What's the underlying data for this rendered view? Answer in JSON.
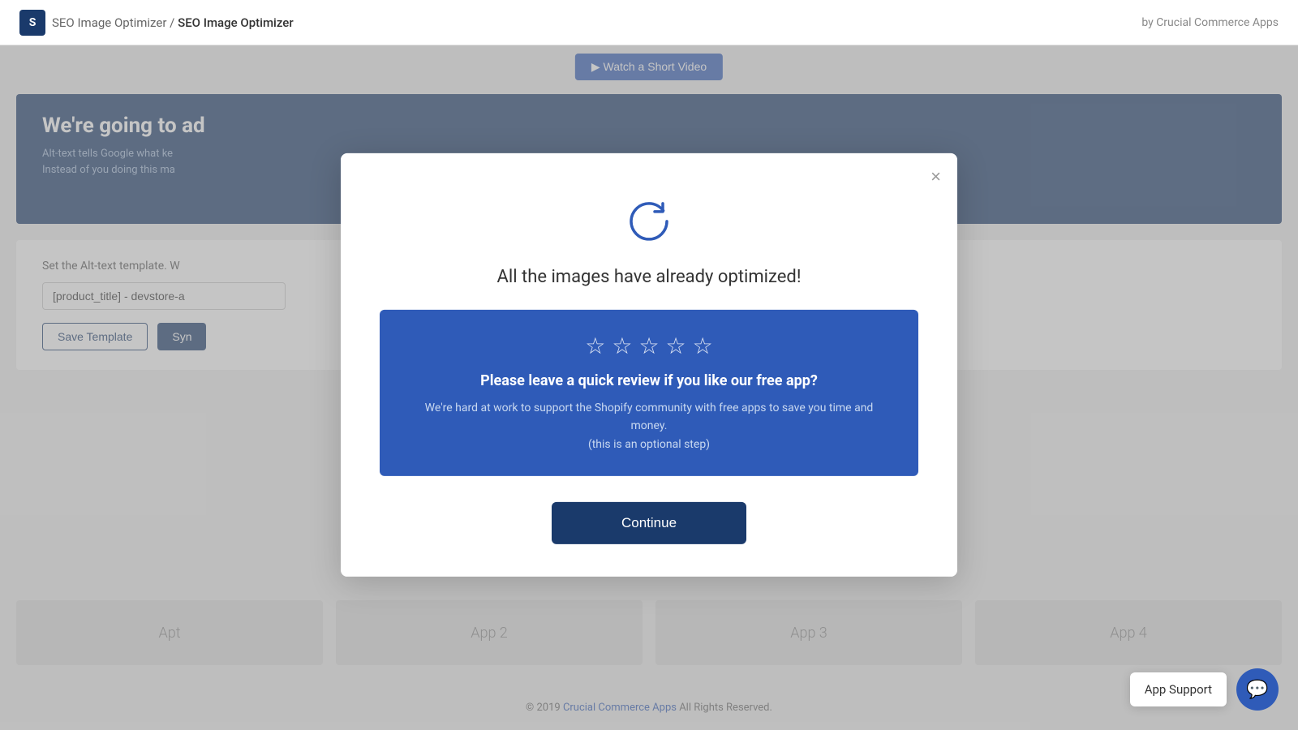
{
  "header": {
    "logo_text": "S",
    "breadcrumb_parent": "SEO Image Optimizer",
    "separator": "/",
    "breadcrumb_current": "SEO Image Optimizer",
    "by_text": "by Crucial Commerce Apps"
  },
  "background": {
    "watch_video_btn": "▶ Watch a Short Video",
    "banner_heading": "We're going to ad",
    "banner_line1": "Alt-text tells Google what ke",
    "banner_line2": "Instead of you doing this ma",
    "template_label": "Set the Alt-text template. W",
    "template_input_value": "[product_title] - devstore-a",
    "save_template_btn": "Save Template",
    "sync_btn": "Syn",
    "app_card_1": "Apt",
    "app_card_2": "App 2",
    "app_card_3": "App 3",
    "app_card_4": "App 4",
    "footer_copy": "© 2019",
    "footer_link": "Crucial Commerce Apps",
    "footer_rights": "All Rights Reserved."
  },
  "modal": {
    "close_label": "×",
    "title": "All the images have already optimized!",
    "review_box": {
      "stars": [
        "☆",
        "☆",
        "☆",
        "☆",
        "☆"
      ],
      "heading": "Please leave a quick review if you like our free app?",
      "desc_line1": "We're hard at work to support the Shopify community with free apps to save you time and money.",
      "desc_line2": "(this is an optional step)"
    },
    "continue_btn": "Continue"
  },
  "app_support": {
    "label": "App Support",
    "chat_icon": "💬"
  }
}
